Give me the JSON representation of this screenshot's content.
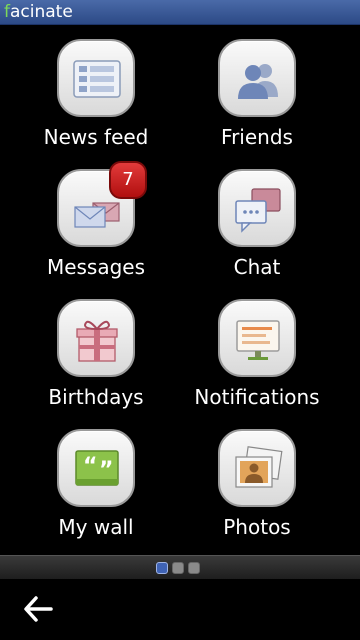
{
  "header": {
    "app_title_prefix": "f",
    "app_title_rest": "acinate"
  },
  "tiles": [
    {
      "label": "News feed",
      "icon": "news-feed-icon"
    },
    {
      "label": "Friends",
      "icon": "friends-icon"
    },
    {
      "label": "Messages",
      "icon": "messages-icon",
      "badge": "7"
    },
    {
      "label": "Chat",
      "icon": "chat-icon"
    },
    {
      "label": "Birthdays",
      "icon": "gift-icon"
    },
    {
      "label": "Notifications",
      "icon": "notifications-icon"
    },
    {
      "label": "My wall",
      "icon": "wall-icon"
    },
    {
      "label": "Photos",
      "icon": "photos-icon"
    }
  ],
  "pager": {
    "pages": 3,
    "current": 1
  },
  "colors": {
    "accent": "#3f63b5",
    "title_green": "#7dd85a",
    "badge_red": "#c81e1e"
  },
  "nav": {
    "back_icon": "back-arrow-icon"
  }
}
